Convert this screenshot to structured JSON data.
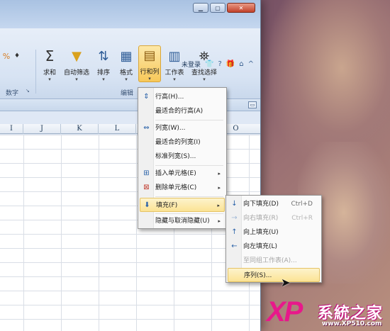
{
  "window": {
    "controls": {
      "minimize": "▁",
      "maximize": "▢",
      "close": "✕"
    },
    "login": "未登录"
  },
  "ribbon": {
    "partial_buttons": [
      "%",
      "♦"
    ],
    "buttons": [
      {
        "name": "sum",
        "label": "求和",
        "icon": "Σ"
      },
      {
        "name": "autofilter",
        "label": "自动筛选",
        "icon": "▼"
      },
      {
        "name": "sort",
        "label": "排序",
        "icon": "⇅"
      },
      {
        "name": "format",
        "label": "格式",
        "icon": "▦"
      },
      {
        "name": "rowcol",
        "label": "行和列",
        "icon": "▤"
      },
      {
        "name": "worksheet",
        "label": "工作表",
        "icon": "▥"
      },
      {
        "name": "find",
        "label": "查找选择",
        "icon": "⛯"
      }
    ],
    "groups": {
      "number": "数字",
      "edit": "编辑"
    }
  },
  "sheet": {
    "columns": [
      "I",
      "J",
      "K",
      "L",
      "O"
    ]
  },
  "menu_main": {
    "items": [
      {
        "label": "行高(H)...",
        "icon": "⇕"
      },
      {
        "label": "最适合的行高(A)"
      },
      {
        "label": "列宽(W)...",
        "icon": "⇔"
      },
      {
        "label": "最适合的列宽(I)"
      },
      {
        "label": "标准列宽(S)..."
      },
      {
        "label": "插入单元格(E)",
        "icon": "⊞"
      },
      {
        "label": "删除单元格(C)",
        "icon": "⊠"
      },
      {
        "label": "填充(F)",
        "icon": "⬇"
      },
      {
        "label": "隐藏与取消隐藏(U)"
      }
    ]
  },
  "menu_fill": {
    "items": [
      {
        "label": "向下填充(D)",
        "shortcut": "Ctrl+D",
        "icon": "↓"
      },
      {
        "label": "向右填充(R)",
        "shortcut": "Ctrl+R",
        "icon": "→"
      },
      {
        "label": "向上填充(U)",
        "icon": "↑"
      },
      {
        "label": "向左填充(L)",
        "icon": "←"
      },
      {
        "label": "至同组工作表(A)..."
      },
      {
        "label": "序列(S)..."
      }
    ]
  },
  "watermark": {
    "logo_text": "XP",
    "brand": "系統之家",
    "url": "www.XP510.com"
  }
}
